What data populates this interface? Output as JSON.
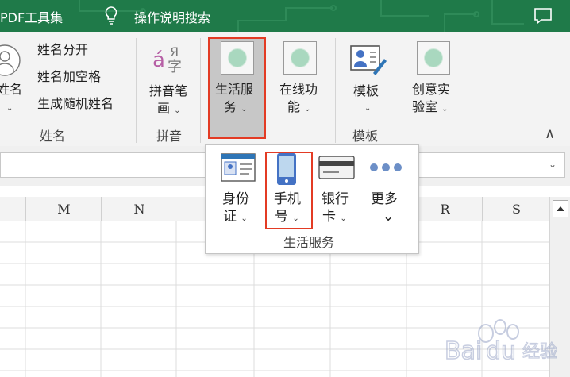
{
  "tabs": {
    "pdf_tools": "PDF工具集",
    "help_search": "操作说明搜索"
  },
  "ribbon": {
    "name_group": {
      "big_button": {
        "label_line1": "姓名",
        "caret": "⌄"
      },
      "split_name": "姓名分开",
      "add_spaces": "姓名加空格",
      "random_names": "生成随机姓名",
      "group_label": "姓名"
    },
    "pinyin_group": {
      "icon_text": "áЯ字",
      "pen_label_line1": "拼音笔",
      "pen_label_line2": "画",
      "caret": "⌄",
      "group_label": "拼音"
    },
    "life_service": {
      "label_line1": "生活服",
      "label_line2": "务",
      "caret": "⌄"
    },
    "online": {
      "label_line1": "在线功",
      "label_line2": "能",
      "caret": "⌄"
    },
    "template_group": {
      "label": "模板",
      "caret": "⌄",
      "group_label": "模板"
    },
    "lab": {
      "label_line1": "创意实",
      "label_line2": "验室",
      "caret": "⌄"
    },
    "collapse_icon": "∧"
  },
  "dropdown": {
    "items": [
      {
        "label_line1": "身份",
        "label_line2": "证",
        "caret": "⌄"
      },
      {
        "label_line1": "手机",
        "label_line2": "号",
        "caret": "⌄"
      },
      {
        "label_line1": "银行",
        "label_line2": "卡",
        "caret": "⌄"
      },
      {
        "label_line1": "更多",
        "label_line2": "",
        "caret": "⌄"
      }
    ],
    "group_label": "生活服务"
  },
  "sheet": {
    "columns": [
      "M",
      "N",
      "R",
      "S"
    ]
  },
  "watermark": {
    "text": "Baidu 经验"
  },
  "colors": {
    "title_bar": "#1f7a49",
    "ribbon_bg": "#f3f3f3",
    "highlight_border": "#e33b24",
    "pressed_bg": "#c7c7c7",
    "icon_placeholder": "#a9d8bf"
  }
}
